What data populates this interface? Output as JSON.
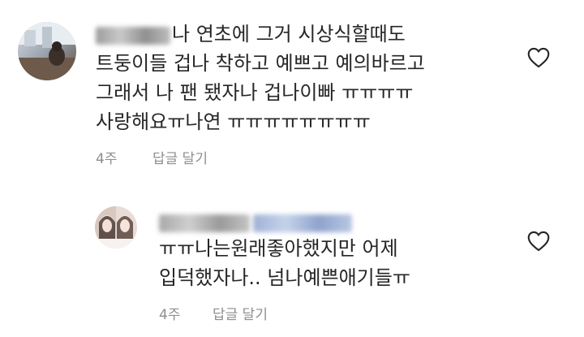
{
  "comments": [
    {
      "lines": [
        "나 연초에 그거 시상식할때도",
        "트둥이들 겁나 착하고 예쁘고 예의바르고",
        "그래서 나 팬 됐자나 겁나이빠 ㅠㅠㅠㅠ",
        "사랑해요ㅠ나연 ㅠㅠㅠㅠㅠㅠㅠㅠ"
      ],
      "time": "4주",
      "reply_label": "답글 달기"
    },
    {
      "lines": [
        "ㅠㅠ나는원래좋아했지만 어제",
        "입덕했자나.. 넘나예쁜애기들ㅠ"
      ],
      "time": "4주",
      "reply_label": "답글 달기"
    }
  ],
  "icons": {
    "avatar_1": "avatar-photo",
    "avatar_2": "avatar-photo",
    "like": "heart-outline-icon"
  },
  "colors": {
    "text": "#262626",
    "meta": "#8e8e8e",
    "background": "#ffffff"
  }
}
